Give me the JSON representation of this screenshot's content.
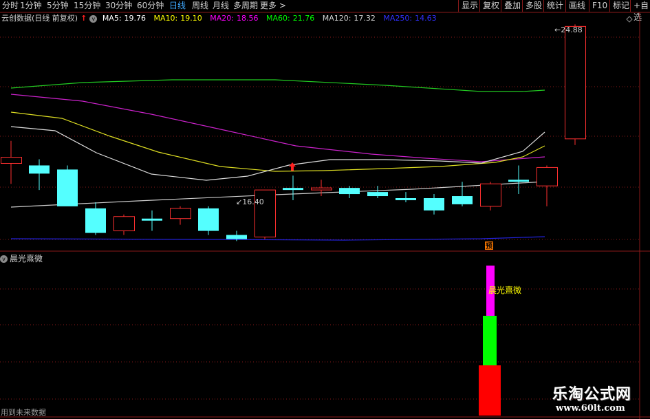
{
  "toolbar": {
    "timeframes": [
      "分时",
      "1分钟",
      "5分钟",
      "15分钟",
      "30分钟",
      "60分钟",
      "日线",
      "周线",
      "月线",
      "多周期",
      "更多 >"
    ],
    "active_timeframe": "日线",
    "right_buttons": [
      "显示",
      "复权",
      "叠加",
      "多股",
      "统计",
      "画线",
      "F10",
      "标记",
      "+自选"
    ]
  },
  "info": {
    "stock": "云创数据(日线 前复权)",
    "ma": [
      {
        "label": "MA5:",
        "value": "19.76",
        "color": "#ffffff"
      },
      {
        "label": "MA10:",
        "value": "19.10",
        "color": "#ffff00"
      },
      {
        "label": "MA20:",
        "value": "18.56",
        "color": "#ff00ff"
      },
      {
        "label": "MA60:",
        "value": "21.76",
        "color": "#00ff00"
      },
      {
        "label": "MA120:",
        "value": "17.32",
        "color": "#d0d0d0"
      },
      {
        "label": "MA250:",
        "value": "14.63",
        "color": "#3030ff"
      }
    ]
  },
  "main_chart": {
    "high_label": "24.88",
    "low_label": "16.40",
    "forecast_marker": "预",
    "candles": [
      {
        "o": 18.1,
        "h": 19.2,
        "l": 17.1,
        "c": 18.4,
        "up": true
      },
      {
        "o": 18.0,
        "h": 18.3,
        "l": 16.8,
        "c": 17.6,
        "up": false
      },
      {
        "o": 17.8,
        "h": 18.0,
        "l": 16.1,
        "c": 16.0,
        "up": false
      },
      {
        "o": 15.9,
        "h": 16.2,
        "l": 14.6,
        "c": 14.7,
        "up": false
      },
      {
        "o": 14.8,
        "h": 15.6,
        "l": 14.6,
        "c": 15.5,
        "up": true
      },
      {
        "o": 15.4,
        "h": 15.8,
        "l": 14.8,
        "c": 15.3,
        "up": false
      },
      {
        "o": 15.4,
        "h": 16.0,
        "l": 15.1,
        "c": 15.9,
        "up": true
      },
      {
        "o": 15.9,
        "h": 16.0,
        "l": 14.6,
        "c": 14.8,
        "up": false
      },
      {
        "o": 14.6,
        "h": 14.8,
        "l": 14.3,
        "c": 14.4,
        "up": false
      },
      {
        "o": 14.5,
        "h": 16.8,
        "l": 14.4,
        "c": 16.8,
        "up": true
      },
      {
        "o": 16.9,
        "h": 17.5,
        "l": 16.3,
        "c": 16.8,
        "up": false
      },
      {
        "o": 16.8,
        "h": 17.3,
        "l": 16.5,
        "c": 16.9,
        "up": true
      },
      {
        "o": 16.9,
        "h": 17.0,
        "l": 16.4,
        "c": 16.6,
        "up": false
      },
      {
        "o": 16.7,
        "h": 17.0,
        "l": 16.4,
        "c": 16.5,
        "up": false
      },
      {
        "o": 16.4,
        "h": 16.7,
        "l": 16.2,
        "c": 16.3,
        "up": false
      },
      {
        "o": 16.4,
        "h": 16.6,
        "l": 15.6,
        "c": 15.8,
        "up": false
      },
      {
        "o": 16.5,
        "h": 17.2,
        "l": 16.0,
        "c": 16.1,
        "up": false
      },
      {
        "o": 16.0,
        "h": 17.2,
        "l": 15.8,
        "c": 17.1,
        "up": true
      },
      {
        "o": 17.3,
        "h": 18.0,
        "l": 16.6,
        "c": 17.2,
        "up": false
      },
      {
        "o": 17.0,
        "h": 18.0,
        "l": 16.0,
        "c": 17.9,
        "up": true
      },
      {
        "o": 19.3,
        "h": 24.9,
        "l": 19.0,
        "c": 24.8,
        "up": true
      }
    ]
  },
  "indicator": {
    "name": "晨光熹微",
    "label": "晨光熹微",
    "bar_segments": [
      {
        "color": "#ff00ff"
      },
      {
        "color": "#00ff00"
      },
      {
        "color": "#ff0000"
      }
    ]
  },
  "footer_text": "用到未来数据",
  "watermark": {
    "line1": "乐淘公式网",
    "line2": "www.60lt.com"
  },
  "colors": {
    "up": "#ff3030",
    "down": "#54ffff",
    "grid": "#8a1a1a"
  }
}
